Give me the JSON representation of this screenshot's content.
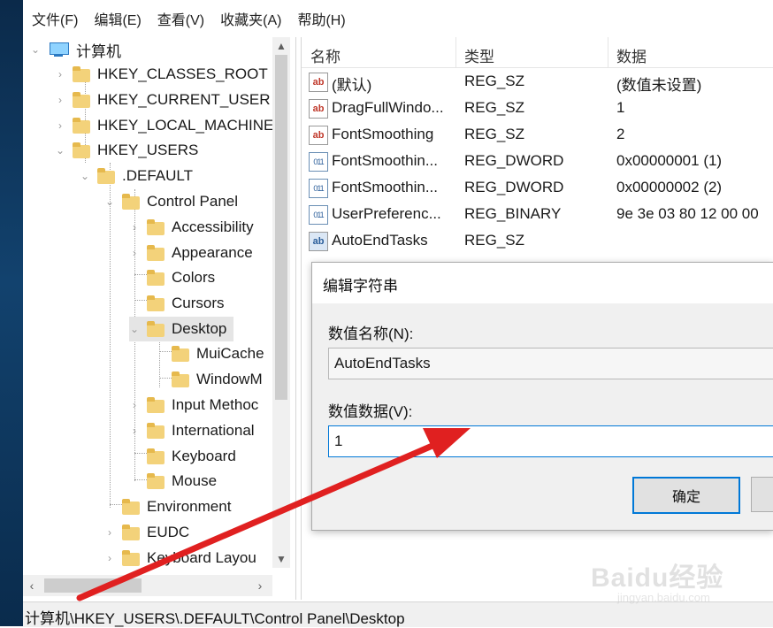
{
  "menu": [
    "文件(F)",
    "编辑(E)",
    "查看(V)",
    "收藏夹(A)",
    "帮助(H)"
  ],
  "tree": {
    "root": "计算机",
    "items": [
      {
        "label": "HKEY_CLASSES_ROOT"
      },
      {
        "label": "HKEY_CURRENT_USER"
      },
      {
        "label": "HKEY_LOCAL_MACHINE"
      },
      {
        "label": "HKEY_USERS"
      },
      {
        "label": ".DEFAULT"
      },
      {
        "label": "Control Panel"
      },
      {
        "label": "Accessibility"
      },
      {
        "label": "Appearance"
      },
      {
        "label": "Colors"
      },
      {
        "label": "Cursors"
      },
      {
        "label": "Desktop"
      },
      {
        "label": "MuiCache"
      },
      {
        "label": "WindowM"
      },
      {
        "label": "Input Methoc"
      },
      {
        "label": "International"
      },
      {
        "label": "Keyboard"
      },
      {
        "label": "Mouse"
      },
      {
        "label": "Environment"
      },
      {
        "label": "EUDC"
      },
      {
        "label": "Keyboard Layou"
      }
    ]
  },
  "list": {
    "headers": {
      "name": "名称",
      "type": "类型",
      "data": "数据"
    },
    "rows": [
      {
        "name": "(默认)",
        "type": "REG_SZ",
        "data": "(数值未设置)",
        "icon": "string-value-icon"
      },
      {
        "name": "DragFullWindo...",
        "type": "REG_SZ",
        "data": "1",
        "icon": "string-value-icon"
      },
      {
        "name": "FontSmoothing",
        "type": "REG_SZ",
        "data": "2",
        "icon": "string-value-icon"
      },
      {
        "name": "FontSmoothin...",
        "type": "REG_DWORD",
        "data": "0x00000001 (1)",
        "icon": "binary-value-icon"
      },
      {
        "name": "FontSmoothin...",
        "type": "REG_DWORD",
        "data": "0x00000002 (2)",
        "icon": "binary-value-icon"
      },
      {
        "name": "UserPreferenc...",
        "type": "REG_BINARY",
        "data": "9e 3e 03 80 12 00 00",
        "icon": "binary-value-icon"
      },
      {
        "name": "AutoEndTasks",
        "type": "REG_SZ",
        "data": "",
        "icon": "string-value-icon"
      }
    ]
  },
  "dialog": {
    "title": "编辑字符串",
    "name_label": "数值名称(N):",
    "name_value": "AutoEndTasks",
    "data_label": "数值数据(V):",
    "data_value": "1",
    "ok_label": "确定"
  },
  "status": {
    "path": "计算机\\HKEY_USERS\\.DEFAULT\\Control Panel\\Desktop"
  },
  "watermark": {
    "logo": "Baidu经验",
    "sub": "jingyan.baidu.com"
  },
  "colors": {
    "accent": "#0078d7",
    "annotation_arrow": "#e02020",
    "selection": "#e5e5e5"
  }
}
